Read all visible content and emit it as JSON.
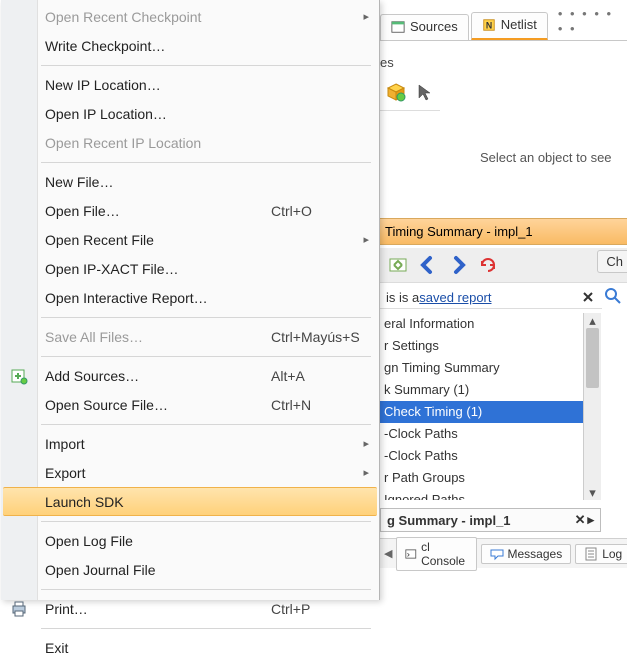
{
  "tabs": {
    "sources": "Sources",
    "netlist": "Netlist",
    "dots": "• • • • • • •"
  },
  "fragments": {
    "es": "es",
    "select_prompt": "Select an object to see"
  },
  "timing": {
    "title": "Timing Summary - impl_1",
    "saved_report_prefix": "is is a ",
    "saved_report_link": "saved report",
    "ch_tab": "Ch",
    "tree": [
      "eral Information",
      "r Settings",
      "gn Timing Summary",
      "k Summary (1)",
      "Check Timing (1)",
      "-Clock Paths",
      "-Clock Paths",
      "r Path Groups",
      "Ignored Paths"
    ],
    "bottom_tab_title": "g Summary - impl_1"
  },
  "bottom_tabs": {
    "console": "cl Console",
    "messages": "Messages",
    "log": "Log"
  },
  "menu": {
    "open_recent_checkpoint": "Open Recent Checkpoint",
    "write_checkpoint": "Write Checkpoint…",
    "new_ip_location": "New IP Location…",
    "open_ip_location": "Open IP Location…",
    "open_recent_ip_location": "Open Recent IP Location",
    "new_file": "New File…",
    "open_file": "Open File…",
    "open_file_shortcut": "Ctrl+O",
    "open_recent_file": "Open Recent File",
    "open_ipxact": "Open IP-XACT File…",
    "open_interactive_report": "Open Interactive Report…",
    "save_all": "Save All Files…",
    "save_all_shortcut": "Ctrl+Mayús+S",
    "add_sources": "Add Sources…",
    "add_sources_shortcut": "Alt+A",
    "open_source_file": "Open Source File…",
    "open_source_file_shortcut": "Ctrl+N",
    "import": "Import",
    "export": "Export",
    "launch_sdk": "Launch SDK",
    "open_log": "Open Log File",
    "open_journal": "Open Journal File",
    "print": "Print…",
    "print_shortcut": "Ctrl+P",
    "exit": "Exit"
  }
}
